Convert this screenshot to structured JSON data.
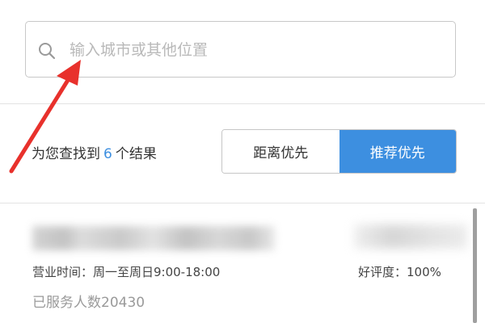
{
  "search": {
    "placeholder": "输入城市或其他位置",
    "value": ""
  },
  "results": {
    "prefix": "为您查找到",
    "count": "6",
    "suffix": "个结果"
  },
  "sort": {
    "options": [
      {
        "label": "距离优先",
        "active": false
      },
      {
        "label": "推荐优先",
        "active": true
      }
    ]
  },
  "store": {
    "hours": "营业时间：周一至周日9:00-18:00",
    "rating": "好评度：100%",
    "served": "已服务人数20430"
  },
  "annotation": {
    "arrow_color": "#e8312c"
  },
  "colors": {
    "accent": "#3d8fe0",
    "border": "#c8c8c8",
    "placeholder": "#b9b9b9"
  }
}
